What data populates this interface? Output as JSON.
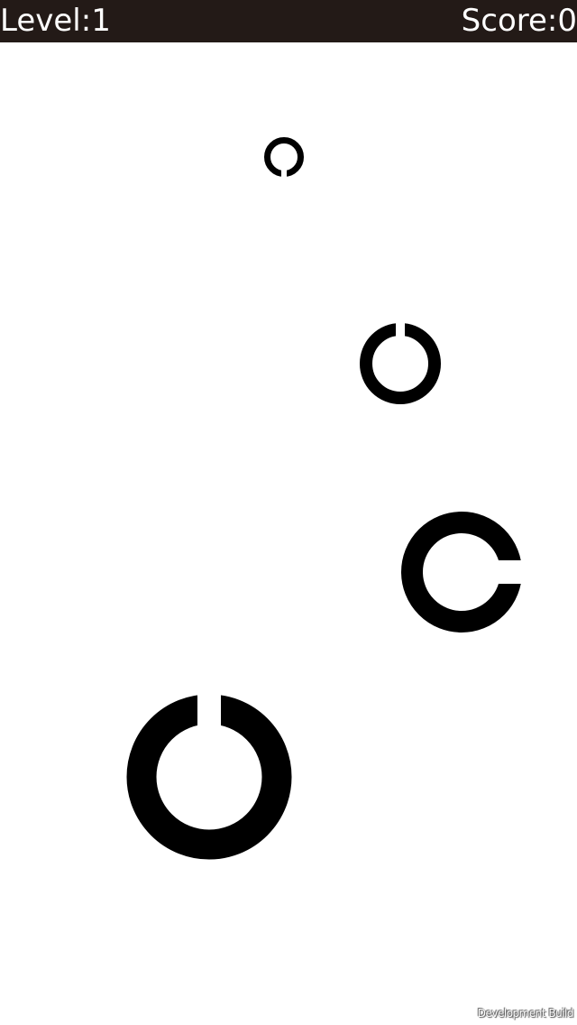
{
  "hud": {
    "level_text": "Level:1",
    "score_text": "Score:0"
  },
  "rings": [
    {
      "name": "ring-small",
      "gap_direction": "bottom"
    },
    {
      "name": "ring-medium",
      "gap_direction": "top"
    },
    {
      "name": "ring-large",
      "gap_direction": "right"
    },
    {
      "name": "ring-xlarge",
      "gap_direction": "top"
    }
  ],
  "footer": {
    "dev_build_label": "Development Build"
  },
  "colors": {
    "hud_background": "#231a17",
    "hud_text": "#ffffff",
    "ring": "#000000",
    "background": "#ffffff"
  }
}
